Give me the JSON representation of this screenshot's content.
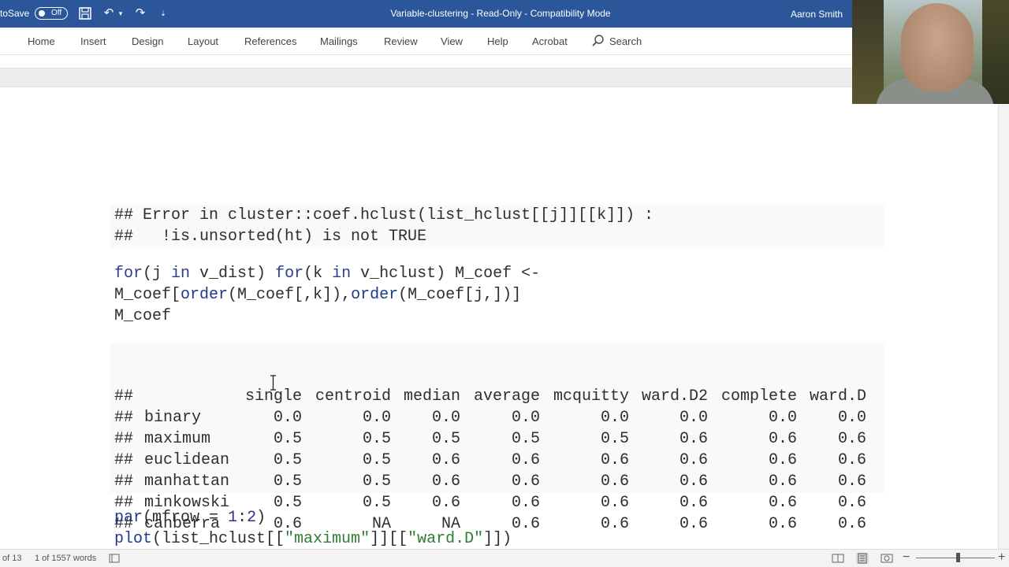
{
  "titlebar": {
    "autosave_label": "toSave",
    "autosave_state": "Off",
    "doc_title": "Variable-clustering  -  Read-Only  -  Compatibility Mode",
    "user_name": "Aaron Smith"
  },
  "ribbon": {
    "tabs": [
      "Home",
      "Insert",
      "Design",
      "Layout",
      "References",
      "Mailings",
      "Review",
      "View",
      "Help",
      "Acrobat"
    ],
    "search_label": "Search"
  },
  "code": {
    "error_line1": "## Error in cluster::coef.hclust(list_hclust[[j]][[k]]) :",
    "error_line2": "##   !is.unsorted(ht) is not TRUE",
    "loop_for1": "for",
    "loop_part1": "(j ",
    "loop_in1": "in",
    "loop_part2": " v_dist) ",
    "loop_for2": "for",
    "loop_part3": "(k ",
    "loop_in2": "in",
    "loop_part4": " v_hclust) M_coef <-",
    "loop2_part1": "M_coef[",
    "loop2_order1": "order",
    "loop2_part2": "(M_coef[,k]),",
    "loop2_order2": "order",
    "loop2_part3": "(M_coef[j,])]",
    "print_line": "M_coef",
    "par_fn": "par",
    "par_arg_open": "(mfrow = ",
    "par_num1": "1",
    "par_colon": ":",
    "par_num2": "2",
    "par_close": ")",
    "plot_fn": "plot",
    "plot_part1": "(list_hclust[[",
    "plot_str1": "\"maximum\"",
    "plot_part2": "]][[",
    "plot_str2": "\"ward.D\"",
    "plot_part3": "]])"
  },
  "matrix": {
    "prefix": "##",
    "columns": [
      "single",
      "centroid",
      "median",
      "average",
      "mcquitty",
      "ward.D2",
      "complete",
      "ward.D"
    ],
    "rows": [
      {
        "name": "binary",
        "values": [
          "0.0",
          "0.0",
          "0.0",
          "0.0",
          "0.0",
          "0.0",
          "0.0",
          "0.0"
        ]
      },
      {
        "name": "maximum",
        "values": [
          "0.5",
          "0.5",
          "0.5",
          "0.5",
          "0.5",
          "0.6",
          "0.6",
          "0.6"
        ]
      },
      {
        "name": "euclidean",
        "values": [
          "0.5",
          "0.5",
          "0.6",
          "0.6",
          "0.6",
          "0.6",
          "0.6",
          "0.6"
        ]
      },
      {
        "name": "manhattan",
        "values": [
          "0.5",
          "0.5",
          "0.6",
          "0.6",
          "0.6",
          "0.6",
          "0.6",
          "0.6"
        ]
      },
      {
        "name": "minkowski",
        "values": [
          "0.5",
          "0.5",
          "0.6",
          "0.6",
          "0.6",
          "0.6",
          "0.6",
          "0.6"
        ]
      },
      {
        "name": "canberra",
        "values": [
          "0.6",
          "NA",
          "NA",
          "0.6",
          "0.6",
          "0.6",
          "0.6",
          "0.6"
        ]
      }
    ]
  },
  "statusbar": {
    "page": "of 13",
    "words": "1 of 1557 words"
  },
  "colors": {
    "titlebar": "#2b579a",
    "keyword": "#2c3e8f",
    "string": "#2e7d32"
  }
}
